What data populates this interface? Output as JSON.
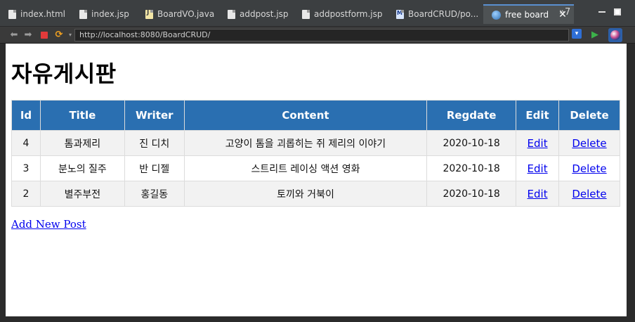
{
  "editor_tabs": [
    {
      "label": "index.html"
    },
    {
      "label": "index.jsp"
    },
    {
      "label": "BoardVO.java"
    },
    {
      "label": "addpost.jsp"
    },
    {
      "label": "addpostform.jsp"
    },
    {
      "label": "BoardCRUD/po..."
    },
    {
      "label": "free board",
      "active": true
    }
  ],
  "tab_overflow": "»7",
  "browser": {
    "url": "http://localhost:8080/BoardCRUD/"
  },
  "page": {
    "title": "자유게시판",
    "table": {
      "headers": [
        "Id",
        "Title",
        "Writer",
        "Content",
        "Regdate",
        "Edit",
        "Delete"
      ],
      "rows": [
        {
          "id": "4",
          "title": "톰과제리",
          "writer": "진 디치",
          "content": "고양이 톰을 괴롭히는 쥐 제리의 이야기",
          "regdate": "2020-10-18",
          "edit": "Edit",
          "delete": "Delete"
        },
        {
          "id": "3",
          "title": "분노의 질주",
          "writer": "반 디젤",
          "content": "스트리트 레이싱 액션 영화",
          "regdate": "2020-10-18",
          "edit": "Edit",
          "delete": "Delete"
        },
        {
          "id": "2",
          "title": "별주부전",
          "writer": "홍길동",
          "content": "토끼와 거북이",
          "regdate": "2020-10-18",
          "edit": "Edit",
          "delete": "Delete"
        }
      ]
    },
    "add_link": "Add New Post"
  },
  "colors": {
    "table_header_bg": "#2a6fb1",
    "link": "#0000ee",
    "stripe": "#f2f2f2"
  }
}
